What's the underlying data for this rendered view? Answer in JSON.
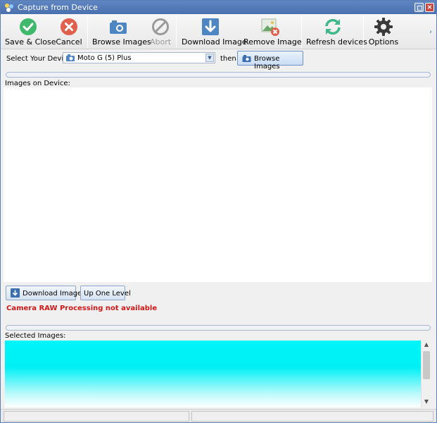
{
  "window": {
    "title": "Capture from Device"
  },
  "toolbar": {
    "save_close": "Save & Close",
    "cancel": "Cancel",
    "browse_images": "Browse Images",
    "abort": "Abort",
    "download_image": "Download Image",
    "remove_image": "Remove Image",
    "refresh_devices": "Refresh devices",
    "options": "Options"
  },
  "device": {
    "label": "Select Your Device",
    "selected": "Moto G (5) Plus",
    "then": "then",
    "browse_button": "Browse Images"
  },
  "images_on_device": {
    "label": "Images on Device:"
  },
  "actions": {
    "download_image": "Download Image",
    "up_one_level": "Up One Level"
  },
  "raw_note": "Camera RAW Processing not available",
  "selected_images": {
    "label": "Selected Images:"
  },
  "colors": {
    "title_bar": "#4f76b4",
    "save_green": "#3fb96b",
    "cancel_red": "#e0604c",
    "accent_blue": "#4e86c4",
    "refresh_green": "#3fb98a",
    "warning_red": "#d01818",
    "selected_panel": "#00f4f8"
  }
}
